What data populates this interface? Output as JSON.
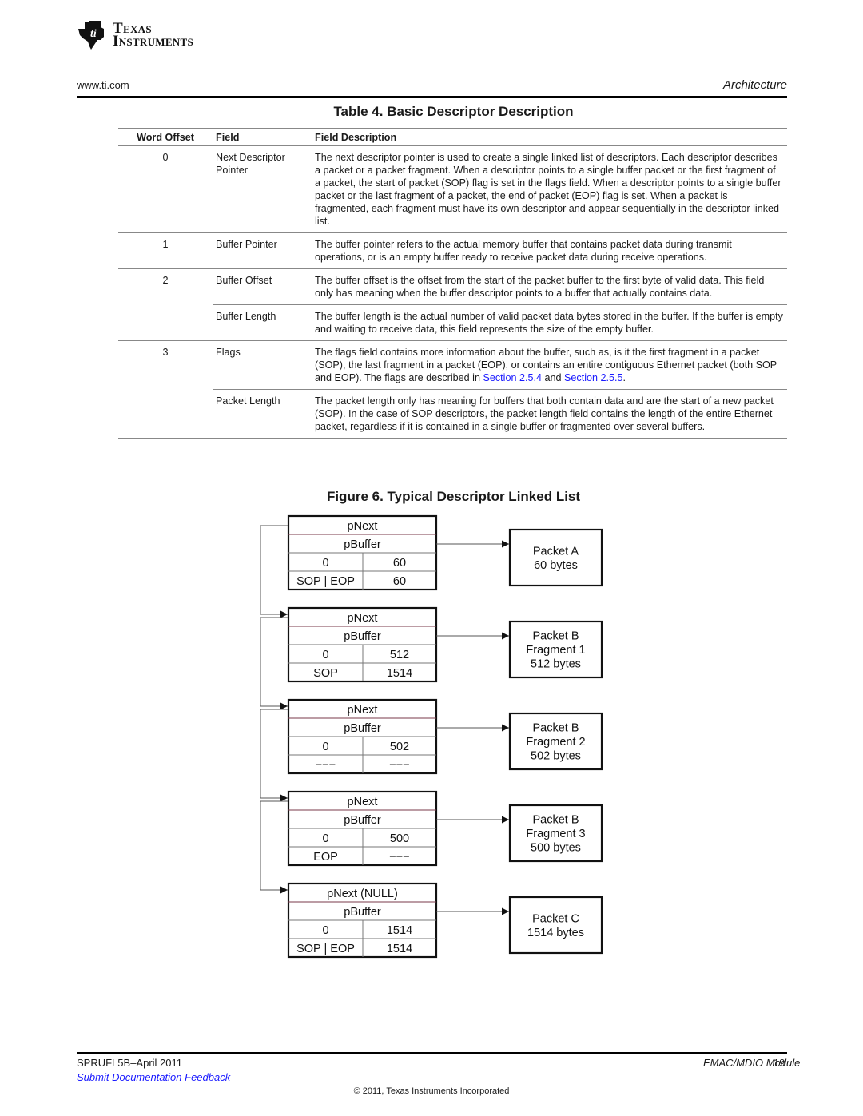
{
  "header": {
    "logo": {
      "line1": "Texas",
      "line2": "Instruments",
      "icon": "ti-logo-icon"
    },
    "website": "www.ti.com",
    "section": "Architecture"
  },
  "table": {
    "title": "Table 4. Basic Descriptor Description",
    "columns": [
      "Word Offset",
      "Field",
      "Field Description"
    ],
    "rows": [
      {
        "offset": "0",
        "field": "Next Descriptor Pointer",
        "description": "The next descriptor pointer is used to create a single linked list of descriptors. Each descriptor describes a packet or a packet fragment. When a descriptor points to a single buffer packet or the first fragment of a packet, the start of packet (SOP) flag is set in the flags field. When a descriptor points to a single buffer packet or the last fragment of a packet, the end of packet (EOP) flag is set. When a packet is fragmented, each fragment must have its own descriptor and appear sequentially in the descriptor linked list."
      },
      {
        "offset": "1",
        "field": "Buffer Pointer",
        "description": "The buffer pointer refers to the actual memory buffer that contains packet data during transmit operations, or is an empty buffer ready to receive packet data during receive operations."
      },
      {
        "offset": "2",
        "field": "Buffer Offset",
        "description": "The buffer offset is the offset from the start of the packet buffer to the first byte of valid data. This field only has meaning when the buffer descriptor points to a buffer that actually contains data."
      },
      {
        "offset": "",
        "field": "Buffer Length",
        "description": "The buffer length is the actual number of valid packet data bytes stored in the buffer. If the buffer is empty and waiting to receive data, this field represents the size of the empty buffer."
      },
      {
        "offset": "3",
        "field": "Flags",
        "description_pre": "The flags field contains more information about the buffer, such as, is it the first fragment in a packet (SOP), the last fragment in a packet (EOP), or contains an entire contiguous Ethernet packet (both SOP and EOP). The flags are described in ",
        "link1": "Section 2.5.4",
        "description_mid": " and ",
        "link2": "Section 2.5.5",
        "description_post": "."
      },
      {
        "offset": "",
        "field": "Packet Length",
        "description": "The packet length only has meaning for buffers that both contain data and are the start of a new packet (SOP). In the case of SOP descriptors, the packet length field contains the length of the entire Ethernet packet, regardless if it is contained in a single buffer or fragmented over several buffers."
      }
    ]
  },
  "figure": {
    "title": "Figure 6. Typical Descriptor Linked List",
    "descriptors": [
      {
        "pnext": "pNext",
        "pbuffer": "pBuffer",
        "offset": "0",
        "length": "60",
        "flags": "SOP | EOP",
        "pkt_len": "60",
        "packet": [
          "Packet A",
          "60 bytes"
        ]
      },
      {
        "pnext": "pNext",
        "pbuffer": "pBuffer",
        "offset": "0",
        "length": "512",
        "flags": "SOP",
        "pkt_len": "1514",
        "packet": [
          "Packet B",
          "Fragment 1",
          "512 bytes"
        ]
      },
      {
        "pnext": "pNext",
        "pbuffer": "pBuffer",
        "offset": "0",
        "length": "502",
        "flags": "−−−",
        "pkt_len": "−−−",
        "packet": [
          "Packet B",
          "Fragment 2",
          "502 bytes"
        ]
      },
      {
        "pnext": "pNext",
        "pbuffer": "pBuffer",
        "offset": "0",
        "length": "500",
        "flags": "EOP",
        "pkt_len": "−−−",
        "packet": [
          "Packet B",
          "Fragment 3",
          "500 bytes"
        ]
      },
      {
        "pnext": "pNext (NULL)",
        "pbuffer": "pBuffer",
        "offset": "0",
        "length": "1514",
        "flags": "SOP | EOP",
        "pkt_len": "1514",
        "packet": [
          "Packet C",
          "1514 bytes"
        ]
      }
    ]
  },
  "footer": {
    "doc_id": "SPRUFL5B–April 2011",
    "feedback_link": "Submit Documentation Feedback",
    "module": "EMAC/MDIO Module",
    "page": "19",
    "copyright": "© 2011, Texas Instruments Incorporated"
  }
}
